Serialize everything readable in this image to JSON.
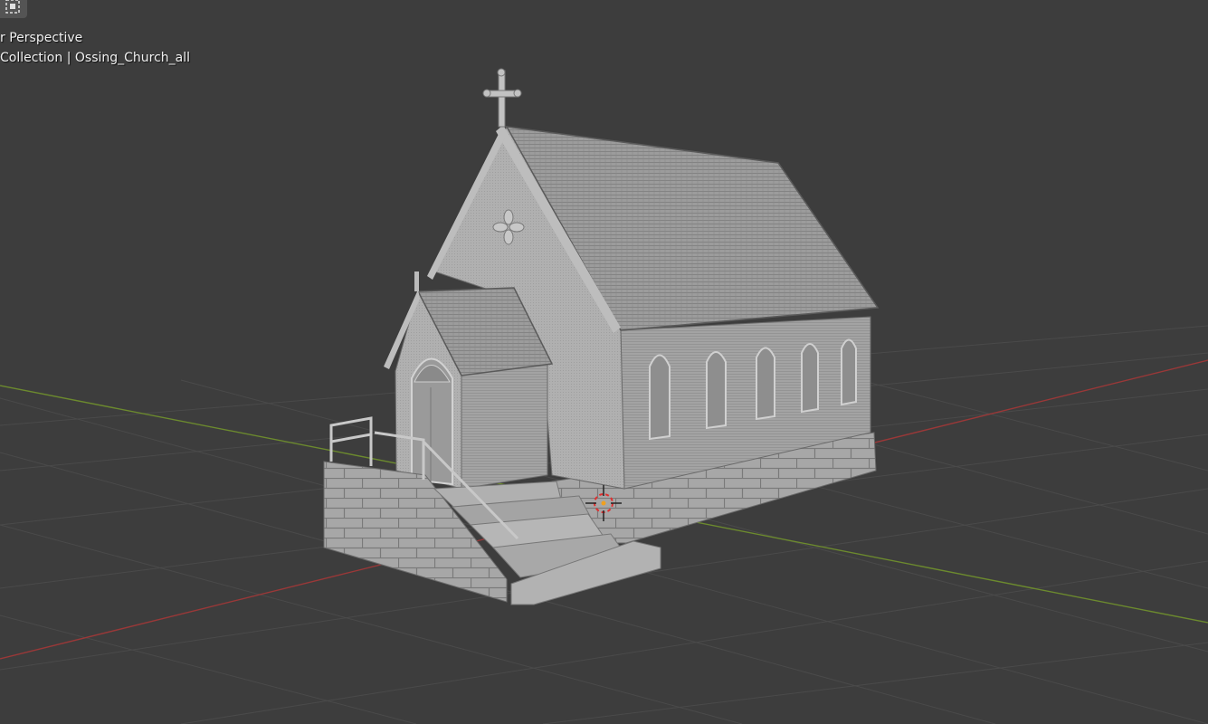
{
  "viewport": {
    "view_name": "r Perspective",
    "collection": "Collection",
    "separator": "|",
    "object_name": "Ossing_Church_all"
  },
  "toolbar": {
    "select_box_icon": "select-box-icon"
  },
  "colors": {
    "background": "#3d3d3d",
    "grid": "#4a4a4a",
    "x_axis": "#9a3838",
    "y_axis": "#6c8a2e",
    "model": "#a9a9a9",
    "cursor": "#e03030"
  }
}
